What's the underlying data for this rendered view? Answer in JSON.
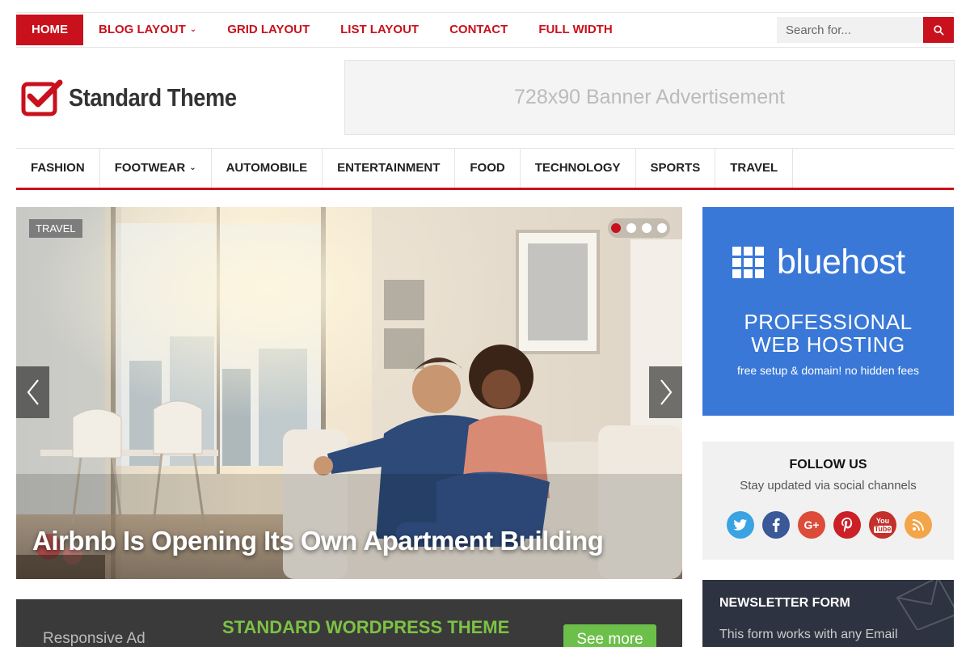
{
  "top_nav": {
    "items": [
      {
        "label": "HOME",
        "active": true
      },
      {
        "label": "BLOG LAYOUT",
        "has_dropdown": true
      },
      {
        "label": "GRID LAYOUT"
      },
      {
        "label": "LIST LAYOUT"
      },
      {
        "label": "CONTACT"
      },
      {
        "label": "FULL WIDTH"
      }
    ],
    "search_placeholder": "Search for...",
    "search_icon": "search-icon"
  },
  "header": {
    "logo_text": "Standard Theme",
    "logo_icon": "checkmark-box-icon",
    "banner_text": "728x90 Banner Advertisement"
  },
  "category_nav": {
    "items": [
      {
        "label": "FASHION"
      },
      {
        "label": "FOOTWEAR",
        "has_dropdown": true
      },
      {
        "label": "AUTOMOBILE"
      },
      {
        "label": "ENTERTAINMENT"
      },
      {
        "label": "FOOD"
      },
      {
        "label": "TECHNOLOGY"
      },
      {
        "label": "SPORTS"
      },
      {
        "label": "TRAVEL"
      }
    ]
  },
  "slider": {
    "tag": "TRAVEL",
    "title": "Airbnb Is Opening Its Own Apartment Building",
    "dots": 4,
    "active_dot": 1
  },
  "bottom_ad": {
    "left_text": "Responsive Ad",
    "center_text": "STANDARD WORDPRESS THEME",
    "button_label": "See more"
  },
  "sidebar": {
    "bluehost": {
      "brand": "bluehost",
      "headline_line1": "PROFESSIONAL",
      "headline_line2": "WEB HOSTING",
      "subtext": "free setup & domain! no hidden fees"
    },
    "follow": {
      "title": "FOLLOW US",
      "subtitle": "Stay updated via social channels",
      "icons": [
        {
          "name": "twitter-icon",
          "color": "#3aa3e3"
        },
        {
          "name": "facebook-icon",
          "color": "#3b5998"
        },
        {
          "name": "google-plus-icon",
          "color": "#dd4b39"
        },
        {
          "name": "pinterest-icon",
          "color": "#cb2027"
        },
        {
          "name": "youtube-icon",
          "color": "#c4302b"
        },
        {
          "name": "rss-icon",
          "color": "#f3a54a"
        }
      ]
    },
    "newsletter": {
      "title": "NEWSLETTER FORM",
      "text": "This form works with any Email"
    }
  },
  "colors": {
    "accent": "#c8111c",
    "bluehost_bg": "#3a78d8",
    "ad_green": "#6cc04a"
  }
}
